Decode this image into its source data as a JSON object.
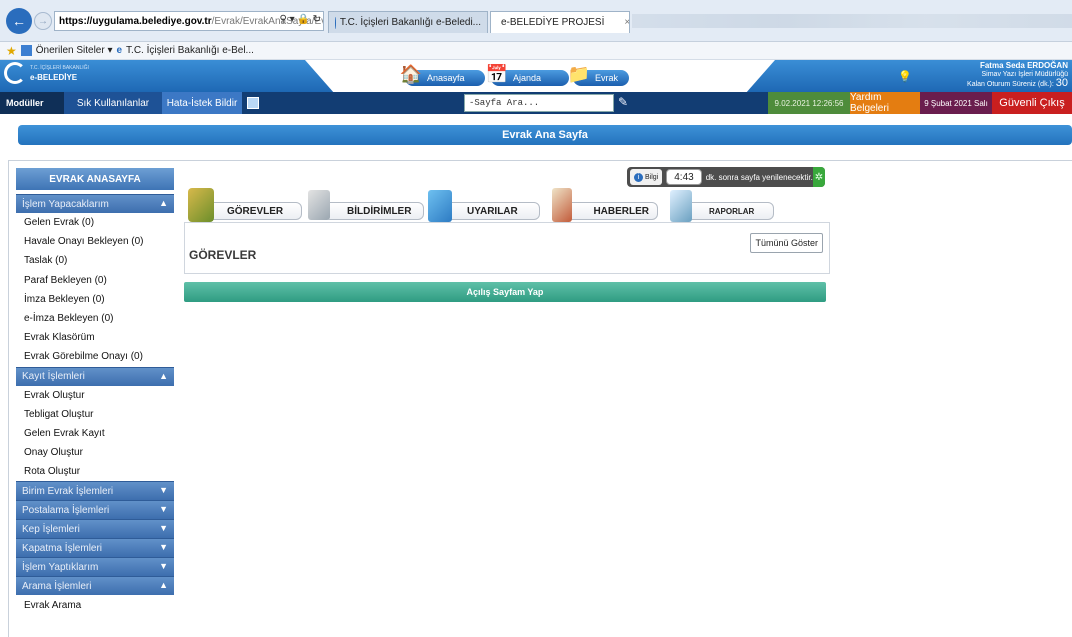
{
  "browser": {
    "url_host": "https://uygulama.belediye.gov.tr",
    "url_path": "/Evrak/EvrakAnaSayfa/EvrakAna",
    "tabs": [
      {
        "label": "T.C. İçişleri Bakanlığı e-Beledi...",
        "active": false
      },
      {
        "label": "e-BELEDİYE PROJESİ",
        "active": true
      }
    ],
    "favorites": {
      "suggested": "Önerilen Siteler ▾",
      "bookmark": "T.C. İçişleri Bakanlığı e-Bel..."
    }
  },
  "app": {
    "logo_small": "T.C. İÇİŞLERİ BAKANLIĞI",
    "logo_name": "e-BELEDİYE",
    "nav": [
      {
        "label": "Anasayfa",
        "icon": "home-icon"
      },
      {
        "label": "Ajanda",
        "icon": "calendar-icon"
      },
      {
        "label": "Evrak",
        "icon": "folder-icon"
      }
    ],
    "user": {
      "name": "Fatma Seda ERDOĞAN",
      "role": "Simav Yazı İşleri Müdürlüğü",
      "session_label": "Kalan Oturum Süreniz (dk.):",
      "session_value": "30"
    }
  },
  "menu": {
    "modules": "Modüller",
    "favorites": "Sık Kullanılanlar",
    "bug": "Hata-İstek Bildir",
    "search_placeholder": "-Sayfa Ara...",
    "datetime": "9.02.2021 12:26:56",
    "help": "Yardım Belgeleri",
    "day": "9 Şubat 2021 Salı",
    "logout": "Güvenli Çıkış"
  },
  "page_title": "Evrak Ana Sayfa",
  "sidebar": {
    "title": "EVRAK ANASAYFA",
    "sections": [
      {
        "label": "İşlem Yapacaklarım",
        "expanded": true,
        "items": [
          "Gelen Evrak (0)",
          "Havale Onayı Bekleyen (0)",
          "Taslak (0)",
          "Paraf Bekleyen (0)",
          "İmza Bekleyen (0)",
          "e-İmza Bekleyen (0)",
          "Evrak Klasörüm",
          "Evrak Görebilme Onayı (0)"
        ]
      },
      {
        "label": "Kayıt İşlemleri",
        "expanded": true,
        "items": [
          "Evrak Oluştur",
          "Tebligat Oluştur",
          "Gelen Evrak Kayıt",
          "Onay Oluştur",
          "Rota Oluştur"
        ]
      },
      {
        "label": "Birim Evrak İşlemleri",
        "expanded": false,
        "items": []
      },
      {
        "label": "Postalama İşlemleri",
        "expanded": false,
        "items": []
      },
      {
        "label": "Kep İşlemleri",
        "expanded": false,
        "items": []
      },
      {
        "label": "Kapatma İşlemleri",
        "expanded": false,
        "items": []
      },
      {
        "label": "İşlem Yaptıklarım",
        "expanded": false,
        "items": []
      },
      {
        "label": "Arama İşlemleri",
        "expanded": true,
        "items": [
          "Evrak Arama"
        ]
      }
    ]
  },
  "info": {
    "label": "Bilgi",
    "timer": "4:43",
    "message": "dk. sonra sayfa yenilenecektir."
  },
  "feature_tabs": [
    {
      "label": "GÖREVLER",
      "icon": "book-icon"
    },
    {
      "label": "BİLDİRİMLER",
      "icon": "document-icon"
    },
    {
      "label": "UYARILAR",
      "icon": "warning-icon"
    },
    {
      "label": "HABERLER",
      "icon": "news-icon"
    },
    {
      "label": "RAPORLAR",
      "icon": "report-icon"
    }
  ],
  "panel": {
    "title": "GÖREVLER",
    "show_all": "Tümünü Göster"
  },
  "home_button": "Açılış Sayfam Yap"
}
